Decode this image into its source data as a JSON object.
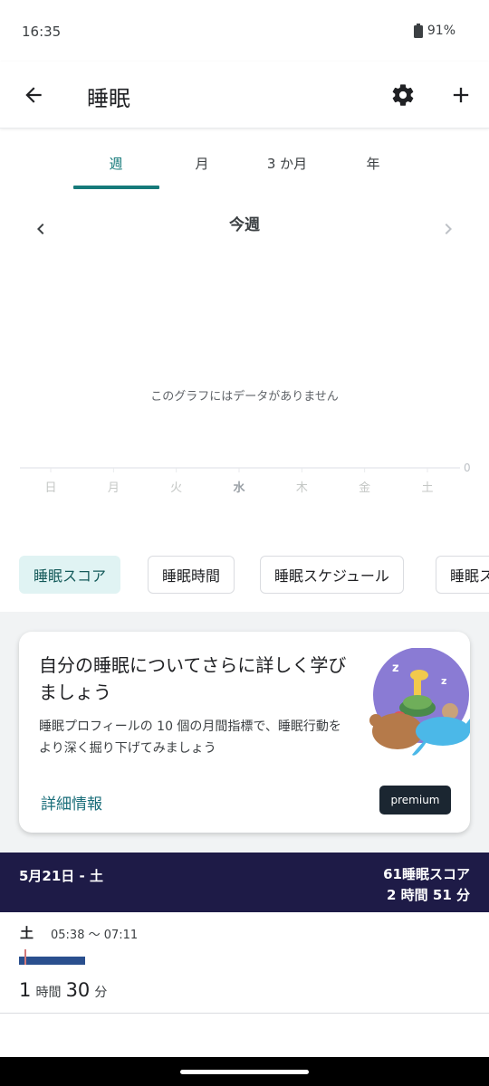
{
  "status": {
    "time": "16:35",
    "battery": "91%"
  },
  "header": {
    "title": "睡眠"
  },
  "tabs": [
    {
      "label": "週",
      "active": true
    },
    {
      "label": "月",
      "active": false
    },
    {
      "label": "3 か月",
      "active": false
    },
    {
      "label": "年",
      "active": false
    }
  ],
  "period": {
    "label": "今週"
  },
  "chart_data": {
    "type": "bar",
    "categories": [
      "日",
      "月",
      "火",
      "水",
      "木",
      "金",
      "土"
    ],
    "values": [],
    "highlighted_category": "水",
    "ytick": "0",
    "empty_message": "このグラフにはデータがありません"
  },
  "chips": [
    "睡眠スコア",
    "睡眠時間",
    "睡眠スケジュール",
    "睡眠ス"
  ],
  "promo": {
    "title": "自分の睡眠についてさらに詳しく学びましょう",
    "description": "睡眠プロフィールの 10 個の月間指標で、睡眠行動をより深く掘り下げてみましょう",
    "link": "詳細情報",
    "badge": "premium"
  },
  "day_summary": {
    "date": "5月21日 - 土",
    "score": "61睡眠スコア",
    "duration": "2 時間 51 分"
  },
  "entry": {
    "day": "土",
    "range": "05:38 〜 07:11",
    "hours": "1",
    "hours_unit": "時間",
    "minutes": "30",
    "minutes_unit": "分"
  },
  "colors": {
    "accent": "#167a7a",
    "header_bg": "#1e1b47",
    "bar": "#2a4f8e"
  }
}
